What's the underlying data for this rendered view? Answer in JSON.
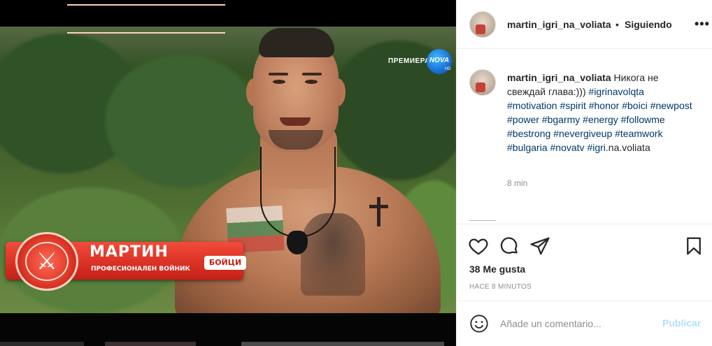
{
  "broadcast": {
    "premiere_label": "ПРЕМИЕРА",
    "channel_logo": "NOVA",
    "hd_badge": "HD",
    "contestant_name": "МАРТИН",
    "contestant_role": "ПРОФЕСИОНАЛЕН ВОЙНИК",
    "team_tag": "БОЙЦИ",
    "emblem_icon": "crossed-swords-icon"
  },
  "header": {
    "username": "martin_igri_na_voliata",
    "separator": "•",
    "follow_status": "Siguiendo",
    "more_icon": "more-options-icon"
  },
  "caption": {
    "username": "martin_igri_na_voliata",
    "text": "Никога не свеждай глава:)))",
    "hashtags": [
      "#igrinavolqta",
      "#motivation",
      "#spirit",
      "#honor",
      "#boici",
      "#newpost",
      "#power",
      "#bgarmy",
      "#energy",
      "#followme",
      "#bestrong",
      "#nevergiveup",
      "#teamwork",
      "#bulgaria",
      "#novatv",
      "#igri"
    ],
    "tail": ".na.voliata",
    "time": "8 min"
  },
  "actions": {
    "like_icon": "heart-icon",
    "comment_icon": "comment-icon",
    "share_icon": "share-icon",
    "save_icon": "bookmark-icon",
    "likes": "38 Me gusta",
    "posted": "HACE 8 MINUTOS"
  },
  "composer": {
    "emoji_icon": "emoji-icon",
    "placeholder": "Añade un comentario...",
    "value": "",
    "publish_label": "Publicar",
    "publish_color": "#b2dffc"
  },
  "colors": {
    "hashtag": "#00376b",
    "text": "#262626",
    "muted": "#8e8e8e",
    "lower_third_red": "#c61f16"
  }
}
